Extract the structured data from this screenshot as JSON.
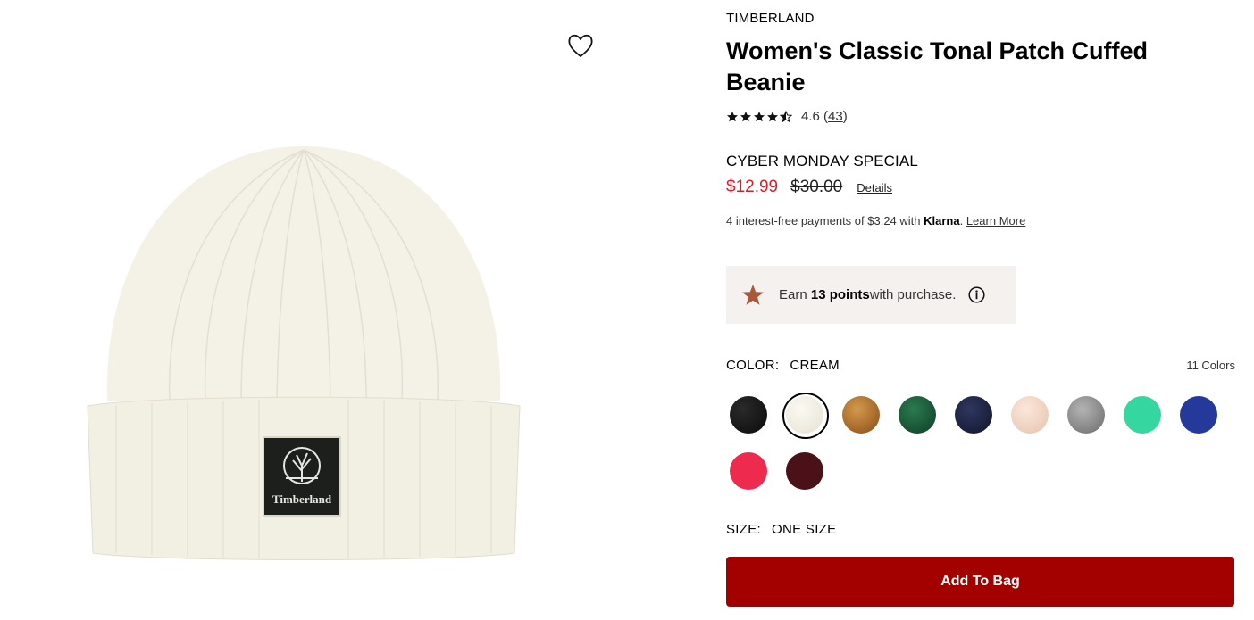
{
  "product": {
    "brand": "TIMBERLAND",
    "title": "Women's Classic Tonal Patch Cuffed Beanie",
    "rating": "4.6",
    "rating_count": "43",
    "rating_stars": 4.6,
    "promo_label": "CYBER MONDAY SPECIAL",
    "sale_price": "$12.99",
    "original_price": "$30.00",
    "details_link": "Details",
    "klarna": {
      "prefix": "4 interest-free payments of $3.24 with ",
      "brand": "Klarna",
      "suffix": ". ",
      "learn_more": "Learn More"
    },
    "points": {
      "prefix": "Earn ",
      "strong": "13 points",
      "suffix": " with purchase."
    },
    "color": {
      "label": "COLOR:",
      "value": "CREAM",
      "count_label": "11 Colors",
      "swatches": [
        {
          "name": "black",
          "color": "#141414"
        },
        {
          "name": "cream",
          "color": "#f3f0e6",
          "selected": true
        },
        {
          "name": "wheat",
          "color": "#b5712a"
        },
        {
          "name": "green",
          "color": "#1a5a39"
        },
        {
          "name": "navy",
          "color": "#1b2140"
        },
        {
          "name": "pink",
          "color": "#f3d6c6"
        },
        {
          "name": "grey",
          "color": "#8c8c8c"
        },
        {
          "name": "mint",
          "color": "#35d6a0"
        },
        {
          "name": "blue",
          "color": "#24399a"
        },
        {
          "name": "red",
          "color": "#ee2b4f"
        },
        {
          "name": "burgundy",
          "color": "#4a1218"
        }
      ]
    },
    "size": {
      "label": "SIZE:",
      "value": "ONE SIZE"
    },
    "add_to_bag": "Add To Bag",
    "image": {
      "patch_text": "Timberland"
    }
  },
  "colors": {
    "sale": "#d61f2c",
    "button": "#a30000",
    "points_bg": "#f5f1ef",
    "points_star": "#a9583a"
  }
}
